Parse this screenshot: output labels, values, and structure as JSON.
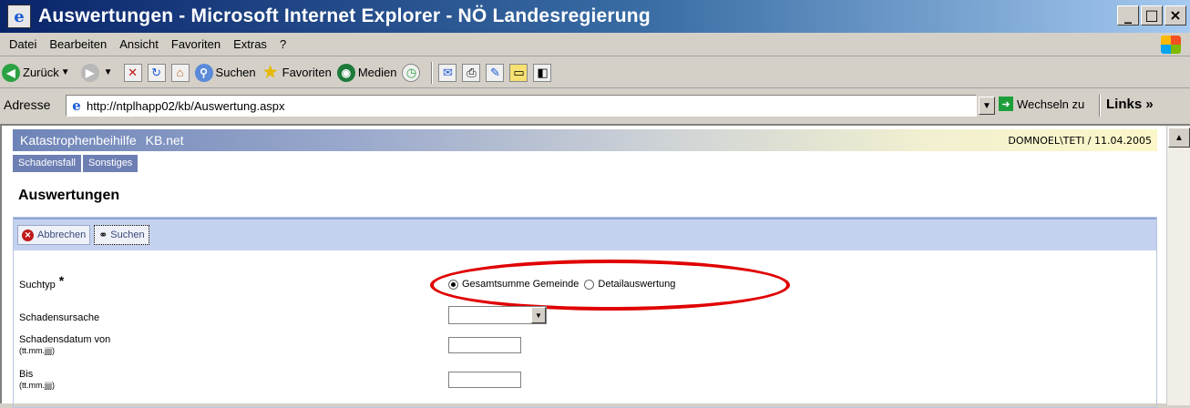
{
  "window": {
    "title": "Auswertungen - Microsoft Internet Explorer - NÖ Landesregierung",
    "controls": {
      "minimize": "_",
      "maximize": "□",
      "close": "×"
    }
  },
  "menu": {
    "items": [
      "Datei",
      "Bearbeiten",
      "Ansicht",
      "Favoriten",
      "Extras",
      "?"
    ]
  },
  "toolbar": {
    "back_label": "Zurück",
    "search_label": "Suchen",
    "favorites_label": "Favoriten",
    "media_label": "Medien"
  },
  "address": {
    "label": "Adresse",
    "url": "http://ntplhapp02/kb/Auswertung.aspx",
    "go_label": "Wechseln zu",
    "links_label": "Links »"
  },
  "app": {
    "name": "Katastrophenbeihilfe",
    "sub": "KB.net",
    "user_date": "DOMNOEL\\TETI / 11.04.2005",
    "nav": [
      "Schadensfall",
      "Sonstiges"
    ]
  },
  "page": {
    "title": "Auswertungen",
    "actions": {
      "cancel": "Abbrechen",
      "search": "Suchen"
    },
    "form": {
      "suchtyp_label": "Suchtyp",
      "required_mark": "*",
      "radio_options": [
        "Gesamtsumme Gemeinde",
        "Detailauswertung"
      ],
      "schadensursache_label": "Schadensursache",
      "datum_von_label": "Schadensdatum von",
      "datum_von_format": "(tt.mm.jjjj)",
      "bis_label": "Bis",
      "bis_format": "(tt.mm.jjjj)"
    }
  },
  "colors": {
    "highlight": "#e00000",
    "nav_bg": "#6e7fb3",
    "action_bar_bg": "#c5d2ef"
  }
}
